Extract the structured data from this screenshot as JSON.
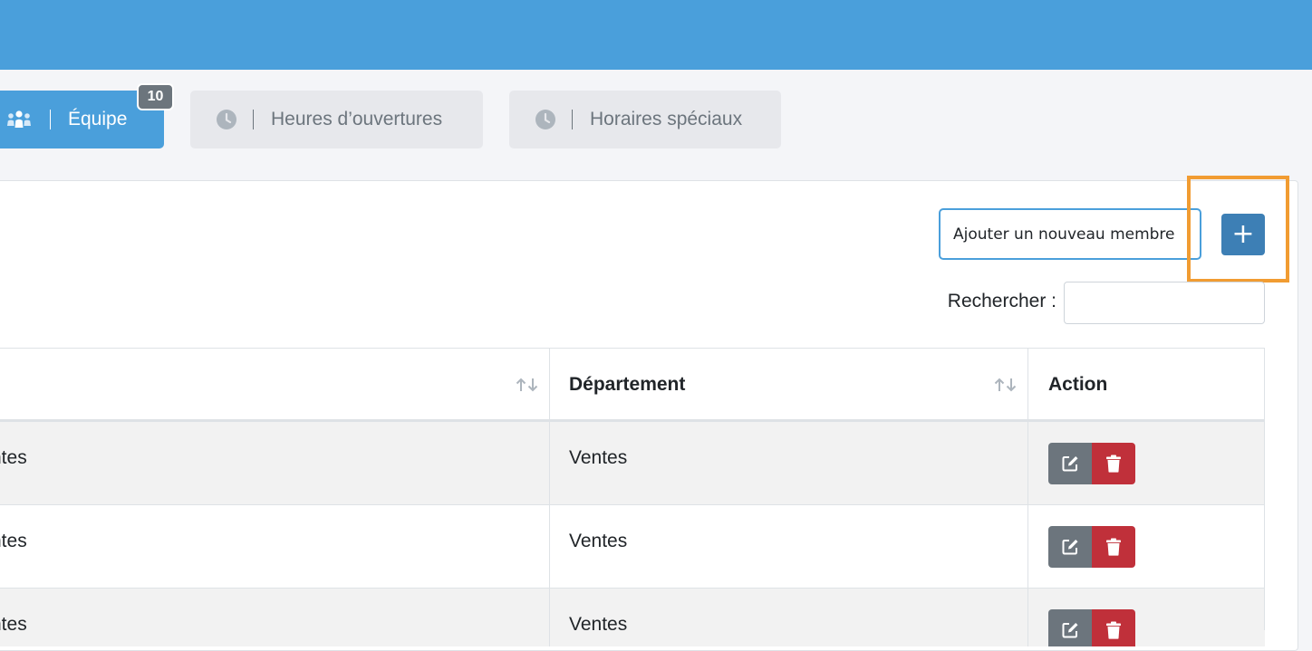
{
  "colors": {
    "topbar": "#4a9fdb",
    "active_tab": "#4a9fdb",
    "add_button": "#3d7fb5",
    "edit_button": "#6c757d",
    "delete_button": "#c0303a",
    "highlight": "#f19c32"
  },
  "tabs": [
    {
      "label": "Équipe",
      "icon": "team-icon",
      "badge": "10",
      "active": true
    },
    {
      "label": "Heures d’ouvertures",
      "icon": "clock-icon",
      "active": false
    },
    {
      "label": "Horaires spéciaux",
      "icon": "clock-icon",
      "active": false
    }
  ],
  "toolbar": {
    "new_member_value": "Ajouter un nouveau membre",
    "add_button_label": "+",
    "search_label": "Rechercher :",
    "search_value": ""
  },
  "table": {
    "columns": [
      "",
      "Département",
      "Action"
    ],
    "rows": [
      {
        "col1": "ntes",
        "department": "Ventes"
      },
      {
        "col1": "ntes",
        "department": "Ventes"
      },
      {
        "col1": "ntes",
        "department": "Ventes"
      }
    ],
    "row_actions": [
      "edit-icon",
      "trash-icon"
    ]
  }
}
